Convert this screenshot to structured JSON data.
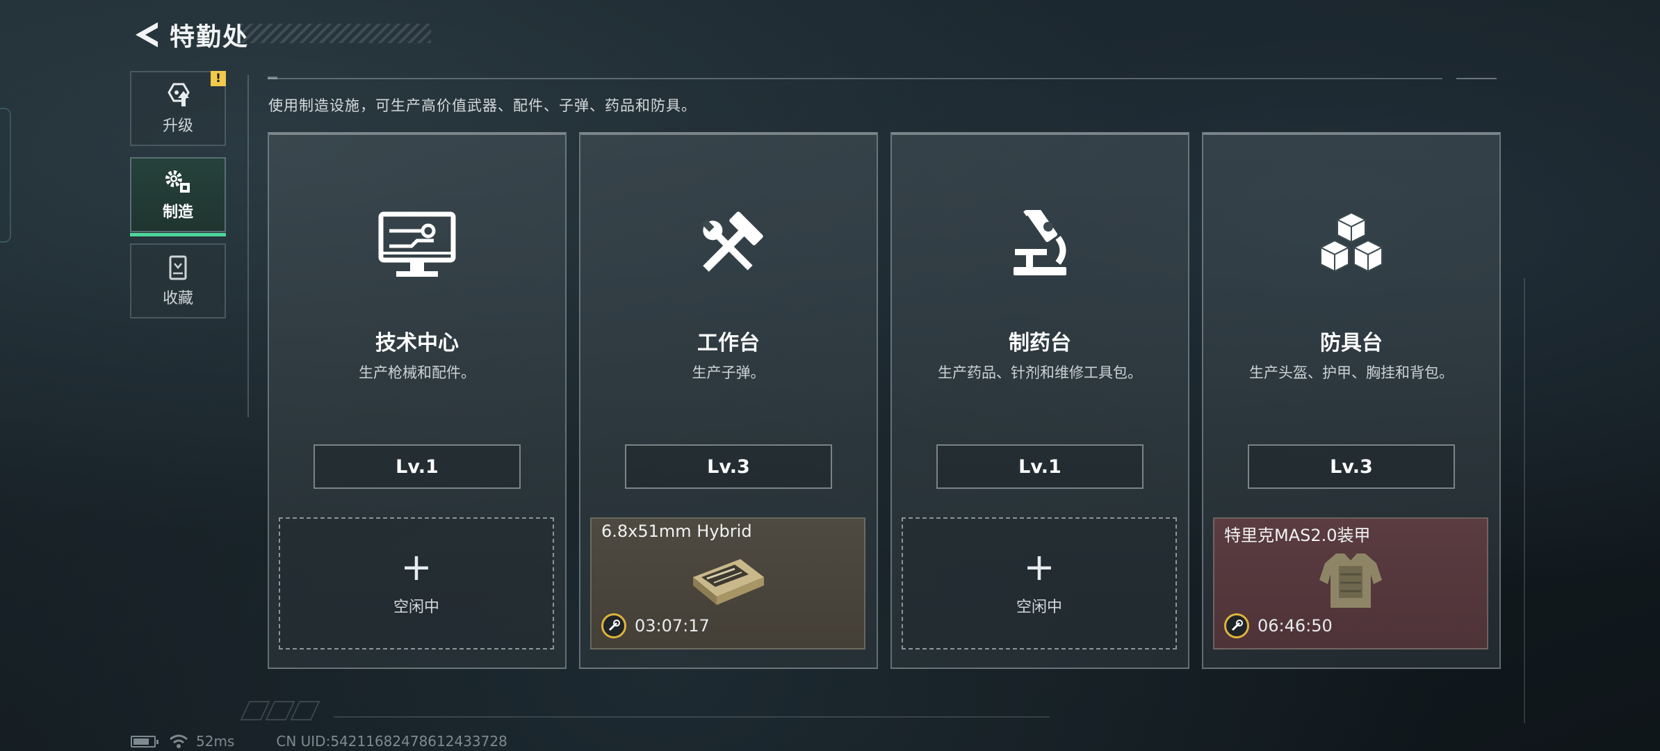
{
  "header": {
    "title": "特勤处"
  },
  "side_nav": {
    "items": [
      {
        "label": "升级",
        "icon": "upgrade-icon",
        "badge": "!",
        "active": false
      },
      {
        "label": "制造",
        "icon": "gears-icon",
        "active": true
      },
      {
        "label": "收藏",
        "icon": "collection-icon",
        "active": false
      }
    ]
  },
  "description": "使用制造设施，可生产高价值武器、配件、子弹、药品和防具。",
  "cards": [
    {
      "name": "技术中心",
      "desc": "生产枪械和配件。",
      "level": "Lv.1",
      "icon": "computer-icon",
      "slot": {
        "state": "idle",
        "plus": "+",
        "label": "空闲中"
      }
    },
    {
      "name": "工作台",
      "desc": "生产子弹。",
      "level": "Lv.3",
      "icon": "hammer-wrench-icon",
      "slot": {
        "state": "busy",
        "item": "6.8x51mm Hybrid",
        "timer": "03:07:17"
      }
    },
    {
      "name": "制药台",
      "desc": "生产药品、针剂和维修工具包。",
      "level": "Lv.1",
      "icon": "microscope-icon",
      "slot": {
        "state": "idle",
        "plus": "+",
        "label": "空闲中"
      }
    },
    {
      "name": "防具台",
      "desc": "生产头盔、护甲、胸挂和背包。",
      "level": "Lv.3",
      "icon": "cubes-icon",
      "slot": {
        "state": "busy",
        "item": "特里克MAS2.0装甲",
        "timer": "06:46:50"
      }
    }
  ],
  "status_bar": {
    "ping": "52ms",
    "uid": "CN UID:54211682478612433728"
  },
  "colors": {
    "accent_green": "#4dd69a",
    "badge_yellow": "#f2c94c",
    "timer_ring": "#e0b43b",
    "ammo_slot": "#4e4a41",
    "armor_slot": "#5a3c41"
  }
}
